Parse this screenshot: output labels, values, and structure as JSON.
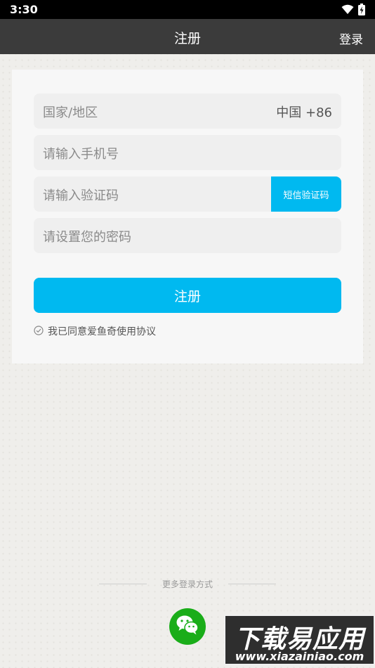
{
  "status_bar": {
    "time": "3:30",
    "icons": [
      "wifi-icon",
      "battery-charging-icon"
    ]
  },
  "app_bar": {
    "title": "注册",
    "login_label": "登录"
  },
  "form": {
    "country_label": "国家/地区",
    "country_value": "中国 +86",
    "phone_placeholder": "请输入手机号",
    "code_placeholder": "请输入验证码",
    "sms_button_label": "短信验证码",
    "password_placeholder": "请设置您的密码",
    "register_label": "注册",
    "agreement_text": "我已同意爱鱼奇使用协议"
  },
  "more_login": {
    "label": "更多登录方式",
    "options": [
      "wechat-icon"
    ]
  },
  "watermark": {
    "title": "下载易应用",
    "url": "www.xiazainiao.com"
  },
  "colors": {
    "accent": "#00b9f0",
    "app_bar": "#3b3b3b",
    "wechat": "#1aad19"
  }
}
